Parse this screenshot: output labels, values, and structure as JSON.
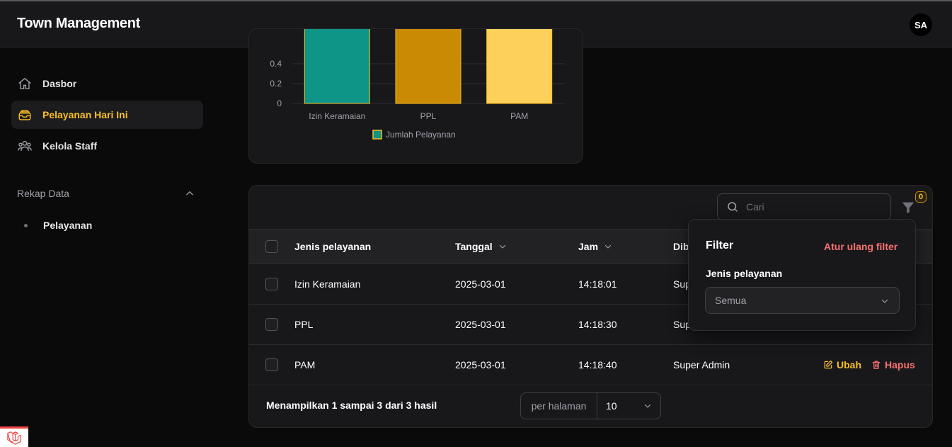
{
  "app": {
    "title": "Town Management",
    "user_initials": "SA"
  },
  "sidebar": {
    "items": [
      {
        "label": "Dasbor",
        "icon": "home-icon"
      },
      {
        "label": "Pelayanan Hari Ini",
        "icon": "inbox-stack-icon",
        "active": true
      },
      {
        "label": "Kelola Staff",
        "icon": "users-icon"
      }
    ],
    "group": {
      "label": "Rekap Data",
      "expanded": true,
      "items": [
        {
          "label": "Pelayanan"
        }
      ]
    }
  },
  "chart_data": {
    "type": "bar",
    "categories": [
      "Izin Keramaian",
      "PPL",
      "PAM"
    ],
    "series": [
      {
        "name": "Jumlah Pelayanan",
        "values": [
          1,
          1,
          1
        ]
      }
    ],
    "ylim": [
      0,
      1
    ],
    "visible_ticks": [
      "0",
      "0.2",
      "0.4"
    ],
    "bar_colors": [
      "#0f9488",
      "#ca8a04",
      "#fcd05a"
    ],
    "legend": "bottom"
  },
  "table": {
    "search_placeholder": "Cari",
    "filter_count": "0",
    "columns": [
      "Jenis pelayanan",
      "Tanggal",
      "Jam",
      "Dib"
    ],
    "rows": [
      {
        "jenis": "Izin Keramaian",
        "tanggal": "2025-03-01",
        "jam": "14:18:01",
        "oleh": "Sup"
      },
      {
        "jenis": "PPL",
        "tanggal": "2025-03-01",
        "jam": "14:18:30",
        "oleh": "Sup"
      },
      {
        "jenis": "PAM",
        "tanggal": "2025-03-01",
        "jam": "14:18:40",
        "oleh": "Super Admin"
      }
    ],
    "actions": {
      "edit": "Ubah",
      "delete": "Hapus"
    },
    "footer": {
      "summary": "Menampilkan 1 sampai 3 dari 3 hasil",
      "per_page_label": "per halaman",
      "per_page_value": "10"
    }
  },
  "filter_popover": {
    "title": "Filter",
    "reset": "Atur ulang filter",
    "field_label": "Jenis pelayanan",
    "field_value": "Semua"
  },
  "colors": {
    "accent": "#fbbf24",
    "danger": "#f87171",
    "surface": "#18181b",
    "background": "#0a0a0a"
  }
}
